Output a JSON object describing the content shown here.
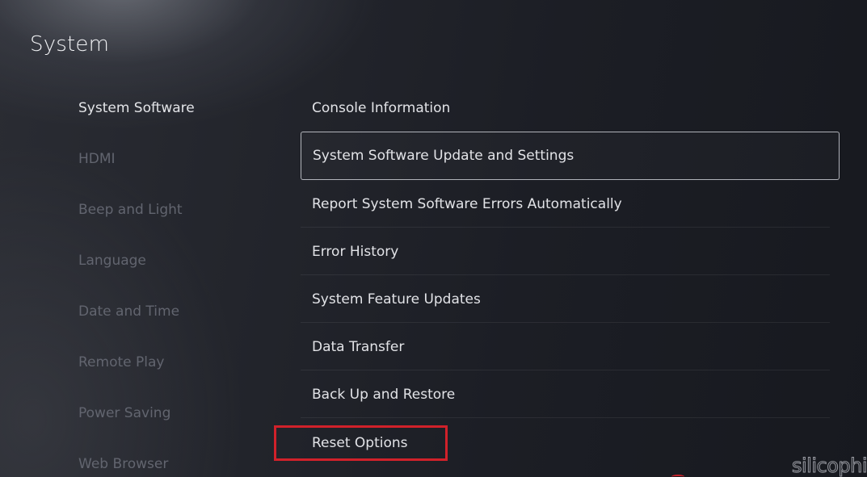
{
  "header": {
    "title": "System"
  },
  "sidebar": {
    "items": [
      {
        "label": "System Software",
        "active": true
      },
      {
        "label": "HDMI",
        "active": false
      },
      {
        "label": "Beep and Light",
        "active": false
      },
      {
        "label": "Language",
        "active": false
      },
      {
        "label": "Date and Time",
        "active": false
      },
      {
        "label": "Remote Play",
        "active": false
      },
      {
        "label": "Power Saving",
        "active": false
      },
      {
        "label": "Web Browser",
        "active": false
      }
    ]
  },
  "main": {
    "items": [
      {
        "label": "Console Information"
      },
      {
        "label": "System Software Update and Settings",
        "focused": true
      },
      {
        "label": "Report System Software Errors Automatically"
      },
      {
        "label": "Error History"
      },
      {
        "label": "System Feature Updates"
      },
      {
        "label": "Data Transfer"
      },
      {
        "label": "Back Up and Restore"
      },
      {
        "label": "Reset Options",
        "highlighted": true
      }
    ]
  },
  "annotation": {
    "highlight_color": "#d1212a"
  },
  "watermark": {
    "text": "silicophi"
  },
  "colors": {
    "background": "#1f2128",
    "text_active": "#e3e4e8",
    "text_inactive": "#62656f",
    "focus_border": "#e1e4eb"
  }
}
